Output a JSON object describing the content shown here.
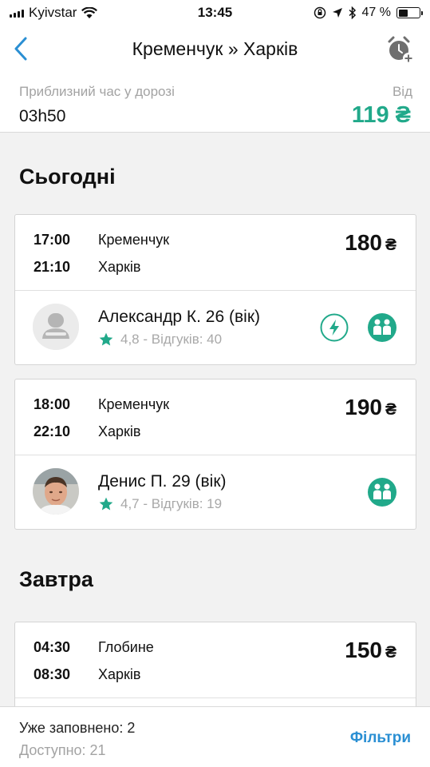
{
  "status_bar": {
    "carrier": "Kyivstar",
    "time": "13:45",
    "battery": "47 %"
  },
  "nav": {
    "title": "Кременчук » Харків"
  },
  "summary": {
    "label": "Приблизний час у дорозі",
    "duration": "03h50",
    "from_label": "Від",
    "price": "119 ₴"
  },
  "sections": [
    {
      "title": "Сьогодні"
    },
    {
      "title": "Завтра"
    }
  ],
  "rides": [
    {
      "dep_time": "17:00",
      "dep_city": "Кременчук",
      "arr_time": "21:10",
      "arr_city": "Харків",
      "price": "180",
      "currency": "₴",
      "driver_name": "Александр К. 26 (вік)",
      "rating": "4,8 - Відгуків: 40",
      "features": [
        "instant-booking-icon",
        "max-two-back-icon"
      ]
    },
    {
      "dep_time": "18:00",
      "dep_city": "Кременчук",
      "arr_time": "22:10",
      "arr_city": "Харків",
      "price": "190",
      "currency": "₴",
      "driver_name": "Денис П. 29 (вік)",
      "rating": "4,7 - Відгуків: 19",
      "features": [
        "max-two-back-icon"
      ]
    },
    {
      "dep_time": "04:30",
      "dep_city": "Глобине",
      "arr_time": "08:30",
      "arr_city": "Харків",
      "price": "150",
      "currency": "₴"
    }
  ],
  "bottom": {
    "filled": "Уже заповнено: 2",
    "available": "Доступно: 21",
    "filters": "Фільтри"
  },
  "colors": {
    "accent_green": "#21a98a",
    "link_blue": "#2a8fd3",
    "background": "#f2f2f2"
  }
}
